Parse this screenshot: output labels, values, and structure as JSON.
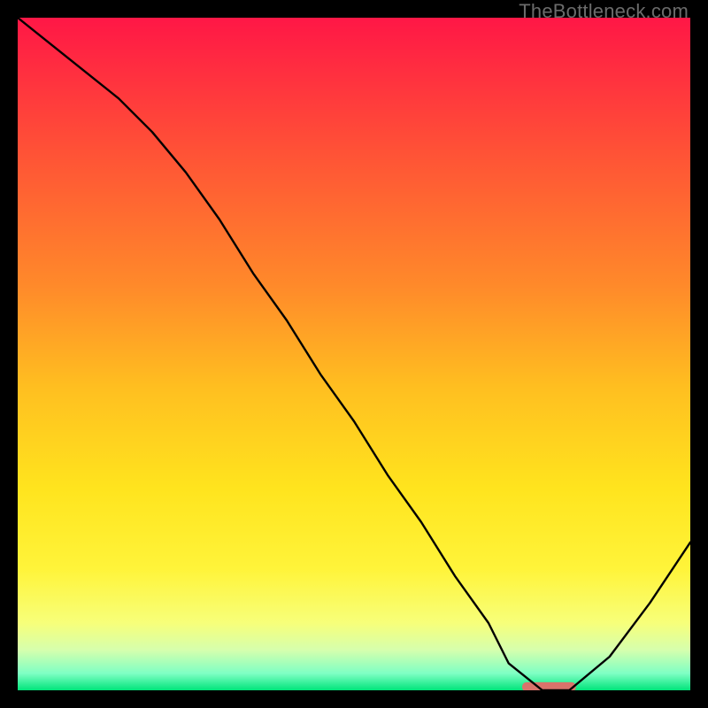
{
  "watermark": "TheBottleneck.com",
  "chart_data": {
    "type": "line",
    "title": "",
    "xlabel": "",
    "ylabel": "",
    "xlim": [
      0,
      100
    ],
    "ylim": [
      0,
      100
    ],
    "grid": false,
    "legend": false,
    "background_gradient": {
      "stops": [
        {
          "offset": 0.0,
          "color": "#ff1746"
        },
        {
          "offset": 0.2,
          "color": "#ff5236"
        },
        {
          "offset": 0.4,
          "color": "#ff8a2a"
        },
        {
          "offset": 0.55,
          "color": "#ffbf20"
        },
        {
          "offset": 0.7,
          "color": "#ffe41e"
        },
        {
          "offset": 0.82,
          "color": "#fff43a"
        },
        {
          "offset": 0.9,
          "color": "#f7ff7a"
        },
        {
          "offset": 0.94,
          "color": "#d6ffad"
        },
        {
          "offset": 0.975,
          "color": "#7effc4"
        },
        {
          "offset": 1.0,
          "color": "#00e47a"
        }
      ]
    },
    "series": [
      {
        "name": "bottleneck-curve",
        "color": "#000000",
        "x": [
          0,
          5,
          10,
          15,
          20,
          25,
          30,
          35,
          40,
          45,
          50,
          55,
          60,
          65,
          70,
          73,
          78,
          82,
          88,
          94,
          100
        ],
        "y": [
          100,
          96,
          92,
          88,
          83,
          77,
          70,
          62,
          55,
          47,
          40,
          32,
          25,
          17,
          10,
          4,
          0,
          0,
          5,
          13,
          22
        ]
      }
    ],
    "marker": {
      "name": "optimal-range",
      "color": "#d9736b",
      "x_start": 75,
      "x_end": 83,
      "y": 0.5,
      "thickness_pct": 1.4
    }
  }
}
